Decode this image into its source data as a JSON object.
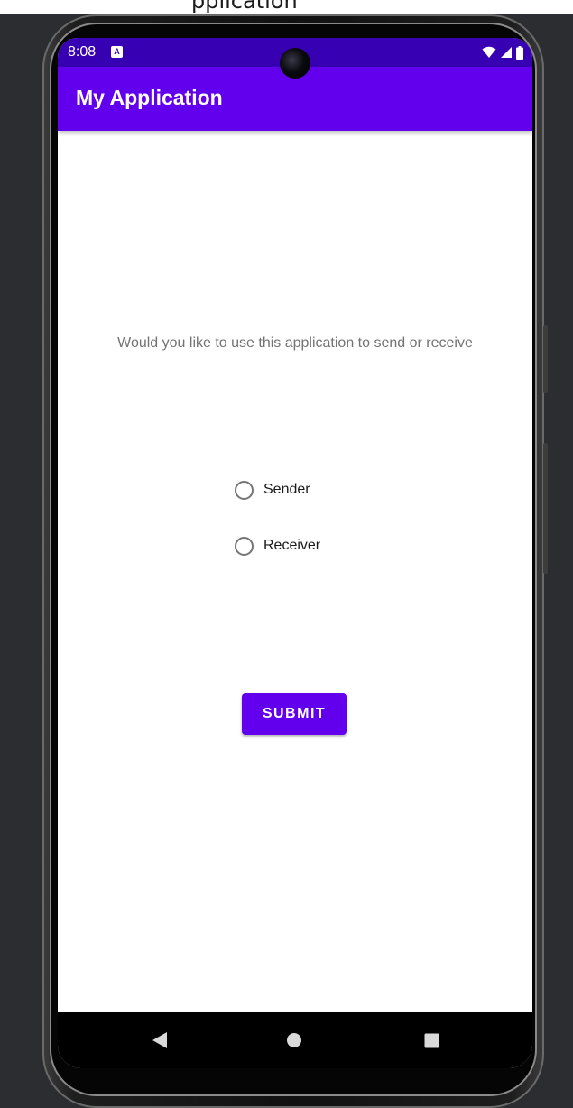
{
  "ide": {
    "partial_title": "pplication"
  },
  "status_bar": {
    "time": "8:08",
    "notification_glyph": "A",
    "icons": [
      "wifi-icon",
      "cell-signal-icon",
      "battery-icon"
    ],
    "color": "#3700b3"
  },
  "app_bar": {
    "title": "My Application",
    "color": "#6200ee"
  },
  "main": {
    "question": "Would you like to use this application to send or receive",
    "radio_options": [
      {
        "label": "Sender",
        "checked": false
      },
      {
        "label": "Receiver",
        "checked": false
      }
    ],
    "submit_label": "SUBMIT"
  },
  "nav_bar": {
    "buttons": [
      "back-icon",
      "home-icon",
      "recents-icon"
    ]
  }
}
